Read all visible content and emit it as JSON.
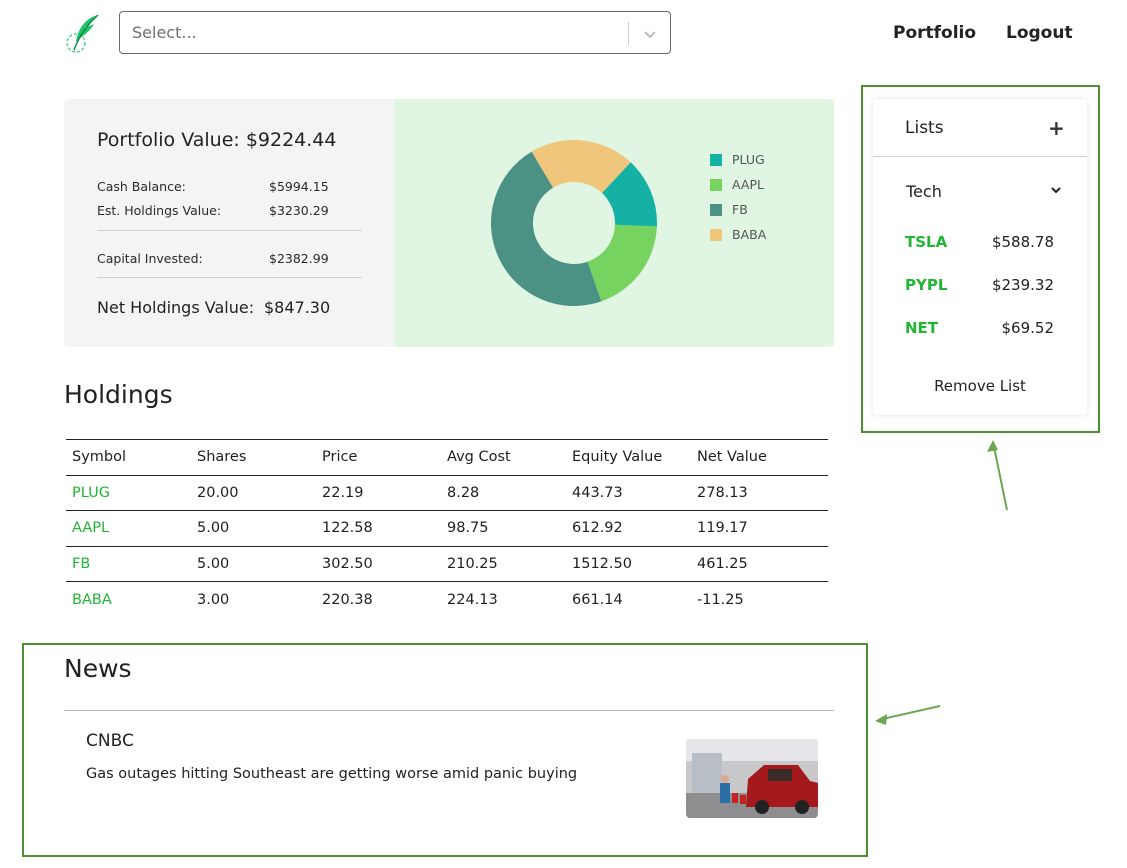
{
  "header": {
    "logo": "feather-logo",
    "search": {
      "placeholder": "Select..."
    },
    "nav": {
      "portfolio": "Portfolio",
      "logout": "Logout"
    }
  },
  "summary": {
    "title": "Portfolio Value: $9224.44",
    "rows": [
      {
        "label": "Cash Balance:",
        "value": "$5994.15"
      },
      {
        "label": "Est. Holdings Value:",
        "value": "$3230.29"
      },
      {
        "label": "Capital Invested:",
        "value": "$2382.99"
      }
    ],
    "net": {
      "label": "Net Holdings Value:",
      "value": "$847.30"
    }
  },
  "chart_data": {
    "type": "pie",
    "labels": [
      "PLUG",
      "AAPL",
      "FB",
      "BABA"
    ],
    "values": [
      443.73,
      612.92,
      1512.5,
      661.14
    ],
    "colors": [
      "#14b1a4",
      "#77d35f",
      "#4b9184",
      "#f0c67c"
    ],
    "legend_position": "right"
  },
  "holdings": {
    "title": "Holdings",
    "columns": [
      "Symbol",
      "Shares",
      "Price",
      "Avg Cost",
      "Equity Value",
      "Net Value"
    ],
    "rows": [
      [
        "PLUG",
        "20.00",
        "22.19",
        "8.28",
        "443.73",
        "278.13"
      ],
      [
        "AAPL",
        "5.00",
        "122.58",
        "98.75",
        "612.92",
        "119.17"
      ],
      [
        "FB",
        "5.00",
        "302.50",
        "210.25",
        "1512.50",
        "461.25"
      ],
      [
        "BABA",
        "3.00",
        "220.38",
        "224.13",
        "661.14",
        "-11.25"
      ]
    ]
  },
  "lists": {
    "title": "Lists",
    "add_icon": "plus-icon",
    "add_label": "+",
    "list_name": "Tech",
    "items": [
      {
        "symbol": "TSLA",
        "price": "$588.78"
      },
      {
        "symbol": "PYPL",
        "price": "$239.32"
      },
      {
        "symbol": "NET",
        "price": "$69.52"
      }
    ],
    "remove_label": "Remove List"
  },
  "news": {
    "title": "News",
    "source": "CNBC",
    "headline": "Gas outages hitting Southeast are getting worse amid panic buying"
  },
  "colors": {
    "accent_green": "#22b534",
    "annotation_green": "#4f8f32",
    "summary_bg": "#f5f4f4",
    "chart_bg": "#e0f6e2"
  }
}
